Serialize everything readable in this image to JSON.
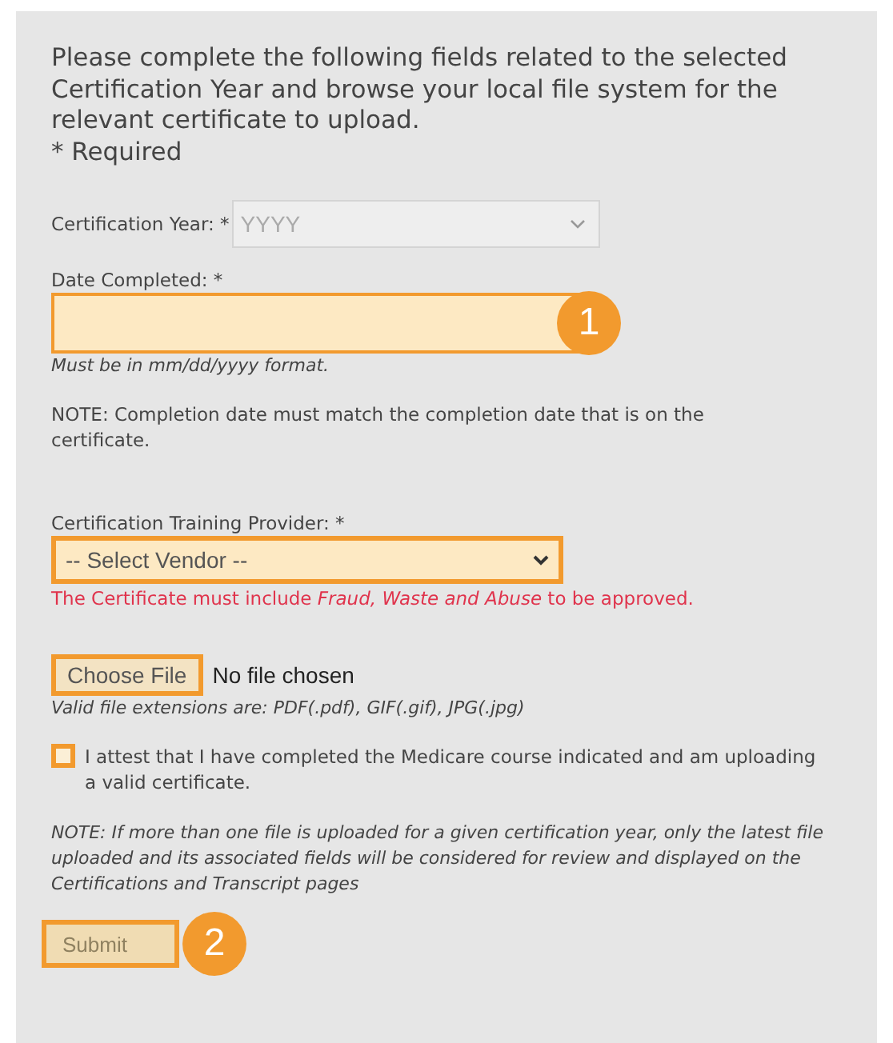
{
  "intro": "Please complete the following fields related to the selected Certification Year and browse your local file system for the relevant certificate to upload.",
  "required_note": "* Required",
  "certification_year": {
    "label": "Certification Year: *",
    "placeholder": "YYYY",
    "disabled": true,
    "highlighted": false
  },
  "date_completed": {
    "label": "Date Completed: *",
    "highlighted": true,
    "callout": "1",
    "hint": "Must be in mm/dd/yyyy format."
  },
  "date_note": "NOTE: Completion date must match the completion date that is on the certificate.",
  "training_provider": {
    "label": "Certification Training Provider: *",
    "value": "-- Select Vendor --",
    "highlighted": true,
    "warning": "The Certificate must include *Fraud, Waste and Abuse* to be approved."
  },
  "file_upload": {
    "button": "Choose File",
    "status": "No file chosen",
    "highlighted": true,
    "hint": "Valid file extensions are: PDF(.pdf), GIF(.gif), JPG(.jpg)"
  },
  "attestation": {
    "label": "I attest that I have completed the Medicare course indicated and am uploading a valid certificate.",
    "checked": false,
    "highlighted": true
  },
  "upload_note": "NOTE: If more than one file is uploaded for a given certification year, only the latest file uploaded and its associated fields will be considered for review and displayed on the Certifications and Transcript pages",
  "submit": {
    "label": "Submit",
    "disabled": true,
    "highlighted": true,
    "callout": "2"
  }
}
